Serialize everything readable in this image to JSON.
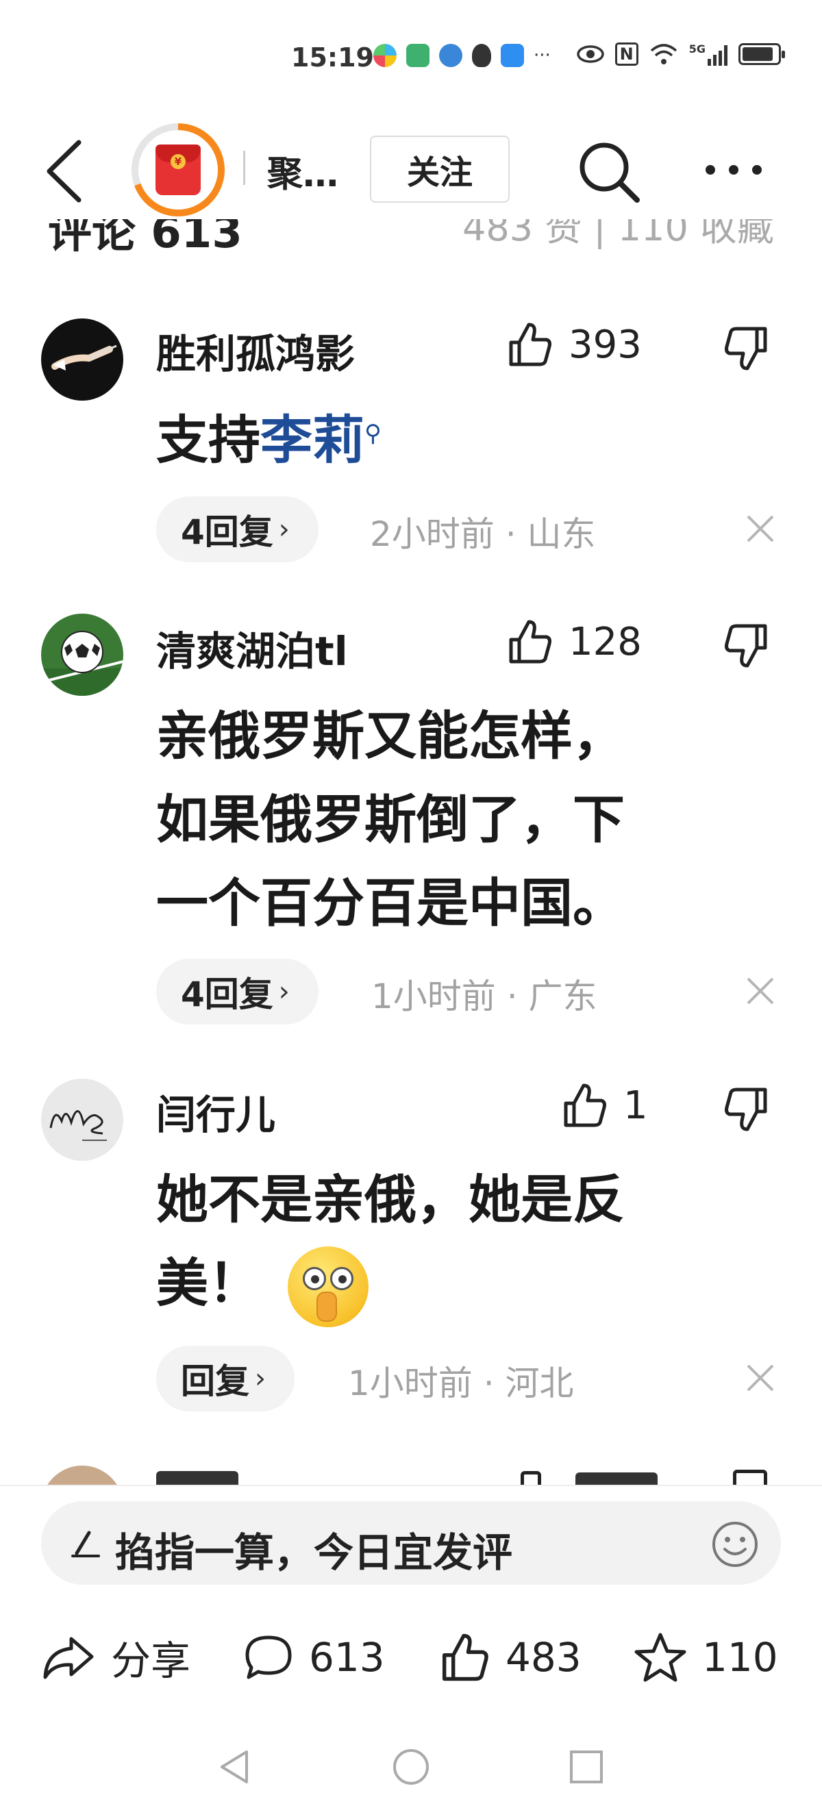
{
  "status_bar": {
    "time": "15:19",
    "more_indicator": "···",
    "signal_label": "5G",
    "nfc_label": "N"
  },
  "nav": {
    "channel_name": "聚…",
    "follow_label": "关注"
  },
  "cut_off": {
    "left_text": "评论 613",
    "right_text": "483 赞 | 110 收藏"
  },
  "comments": [
    {
      "author": "胜利孤鸿影",
      "likes": "393",
      "text_prefix": "支持",
      "text_link": "李莉",
      "reply_label": "4回复",
      "time": "2小时前",
      "location": "山东"
    },
    {
      "author": "清爽湖泊tl",
      "likes": "128",
      "text_lines": [
        "亲俄罗斯又能怎样，",
        "如果俄罗斯倒了，下",
        "一个百分百是中国。"
      ],
      "reply_label": "4回复",
      "time": "1小时前",
      "location": "广东"
    },
    {
      "author": "闫行儿",
      "likes": "1",
      "text_lines": [
        "她不是亲俄，她是反",
        "美！"
      ],
      "reply_label": "回复",
      "time": "1小时前",
      "location": "河北"
    }
  ],
  "bottom": {
    "input_placeholder": "掐指一算，今日宜发评",
    "share_label": "分享",
    "comment_count": "613",
    "like_count": "483",
    "favorite_count": "110"
  },
  "meta_separator": " · ",
  "colors": {
    "link": "#1e4c97",
    "meta_gray": "#a2a2a2",
    "accent_orange": "#f7891c",
    "red_packet": "#e63232"
  }
}
